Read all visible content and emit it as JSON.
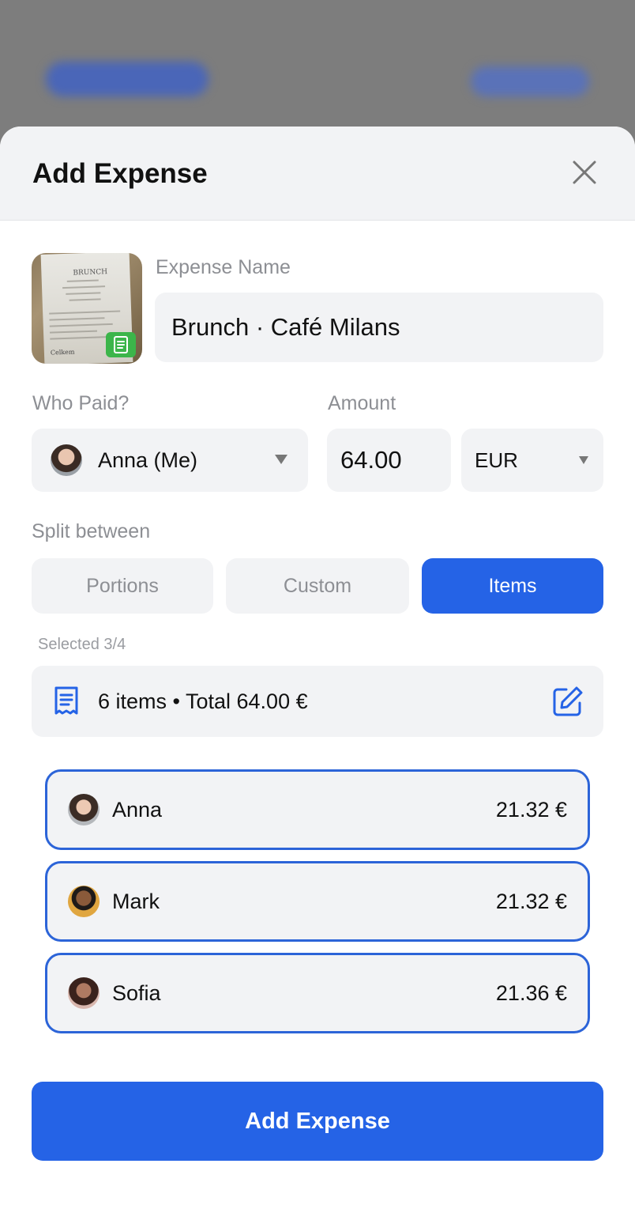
{
  "header": {
    "title": "Add Expense"
  },
  "icons": {
    "close": "close-icon",
    "receipt_badge": "receipt-icon",
    "edit": "edit-icon",
    "items_receipt": "receipt-list-icon"
  },
  "expense_name": {
    "label": "Expense Name",
    "value": "Brunch · Café Milans"
  },
  "who_paid": {
    "label": "Who Paid?",
    "value": "Anna (Me)"
  },
  "amount": {
    "label": "Amount",
    "value": "64.00",
    "currency": "EUR"
  },
  "split": {
    "label": "Split between",
    "tabs": [
      {
        "label": "Portions",
        "active": false
      },
      {
        "label": "Custom",
        "active": false
      },
      {
        "label": "Items",
        "active": true
      }
    ],
    "selected_text": "Selected 3/4",
    "summary": "6 items • Total 64.00 €"
  },
  "people": [
    {
      "name": "Anna",
      "amount": "21.32 €"
    },
    {
      "name": "Mark",
      "amount": "21.32 €"
    },
    {
      "name": "Sofia",
      "amount": "21.36 €"
    }
  ],
  "receipt_thumb": {
    "header": "BRUNCH",
    "footer": "Celkem"
  },
  "cta": {
    "label": "Add Expense"
  },
  "colors": {
    "accent": "#2563e6",
    "row_border": "#2c64d8",
    "badge_green": "#3cb54a"
  }
}
